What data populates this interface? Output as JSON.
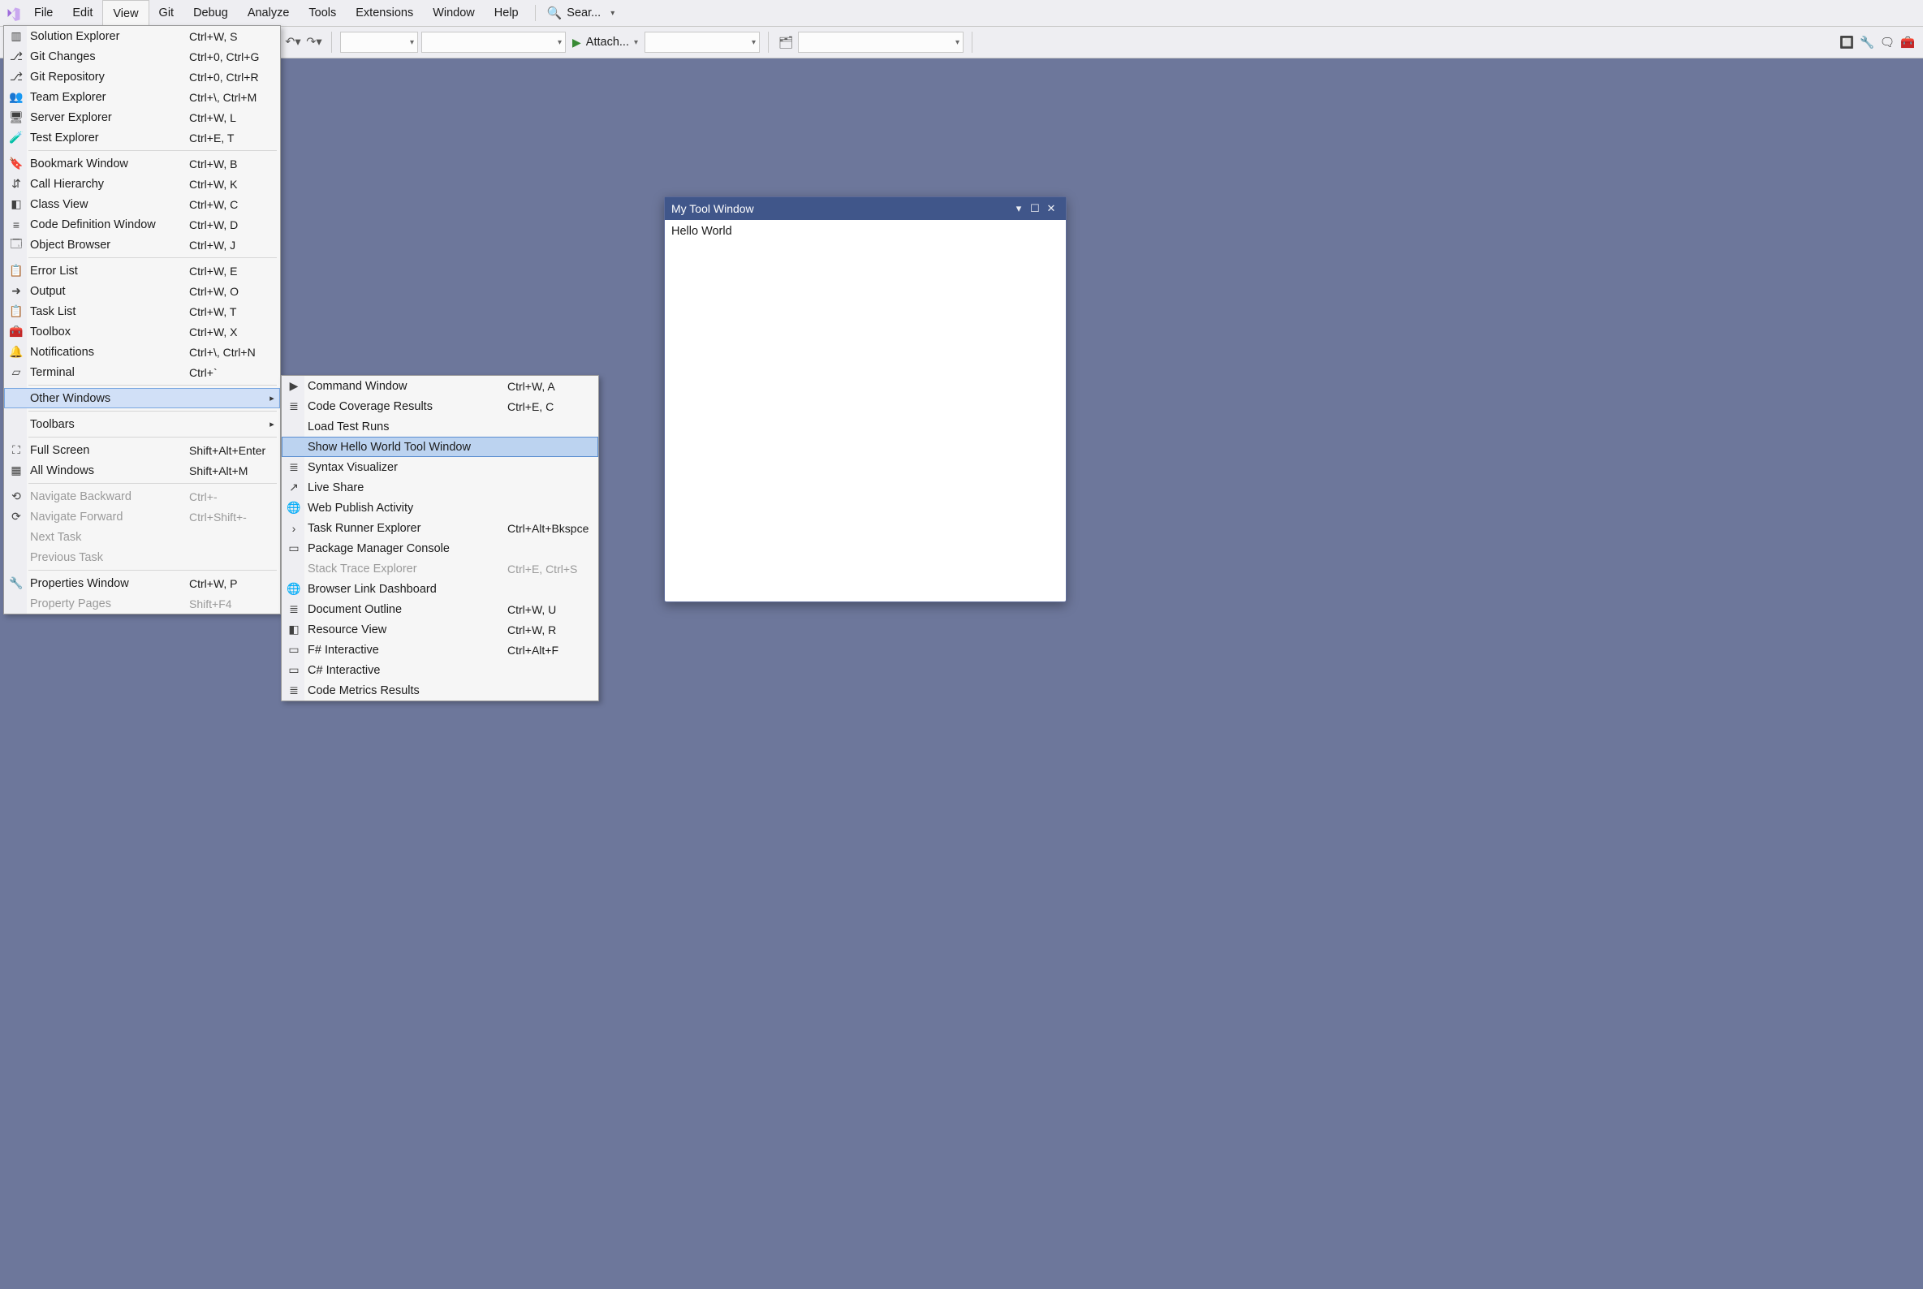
{
  "menubar": {
    "items": [
      "File",
      "Edit",
      "View",
      "Git",
      "Debug",
      "Analyze",
      "Tools",
      "Extensions",
      "Window",
      "Help"
    ],
    "open_index": 2,
    "search_text": "Sear..."
  },
  "toolbar": {
    "attach_label": "Attach..."
  },
  "view_menu": {
    "groups": [
      [
        {
          "icon": "solution",
          "label": "Solution Explorer",
          "shortcut": "Ctrl+W, S"
        },
        {
          "icon": "gitchanges",
          "label": "Git Changes",
          "shortcut": "Ctrl+0, Ctrl+G"
        },
        {
          "icon": "gitrepo",
          "label": "Git Repository",
          "shortcut": "Ctrl+0, Ctrl+R"
        },
        {
          "icon": "team",
          "label": "Team Explorer",
          "shortcut": "Ctrl+\\, Ctrl+M"
        },
        {
          "icon": "server",
          "label": "Server Explorer",
          "shortcut": "Ctrl+W, L"
        },
        {
          "icon": "test",
          "label": "Test Explorer",
          "shortcut": "Ctrl+E, T"
        }
      ],
      [
        {
          "icon": "bookmark",
          "label": "Bookmark Window",
          "shortcut": "Ctrl+W, B"
        },
        {
          "icon": "callhier",
          "label": "Call Hierarchy",
          "shortcut": "Ctrl+W, K"
        },
        {
          "icon": "classview",
          "label": "Class View",
          "shortcut": "Ctrl+W, C"
        },
        {
          "icon": "codedef",
          "label": "Code Definition Window",
          "shortcut": "Ctrl+W, D"
        },
        {
          "icon": "objbrowser",
          "label": "Object Browser",
          "shortcut": "Ctrl+W, J"
        }
      ],
      [
        {
          "icon": "errorlist",
          "label": "Error List",
          "shortcut": "Ctrl+W, E"
        },
        {
          "icon": "output",
          "label": "Output",
          "shortcut": "Ctrl+W, O"
        },
        {
          "icon": "tasklist",
          "label": "Task List",
          "shortcut": "Ctrl+W, T"
        },
        {
          "icon": "toolbox",
          "label": "Toolbox",
          "shortcut": "Ctrl+W, X"
        },
        {
          "icon": "notif",
          "label": "Notifications",
          "shortcut": "Ctrl+\\, Ctrl+N"
        },
        {
          "icon": "terminal",
          "label": "Terminal",
          "shortcut": "Ctrl+`"
        }
      ],
      [
        {
          "icon": "",
          "label": "Other Windows",
          "shortcut": "",
          "submenu": true,
          "selected": true
        }
      ],
      [
        {
          "icon": "",
          "label": "Toolbars",
          "shortcut": "",
          "submenu": true
        }
      ],
      [
        {
          "icon": "fullscreen",
          "label": "Full Screen",
          "shortcut": "Shift+Alt+Enter"
        },
        {
          "icon": "allwin",
          "label": "All Windows",
          "shortcut": "Shift+Alt+M"
        }
      ],
      [
        {
          "icon": "navback",
          "label": "Navigate Backward",
          "shortcut": "Ctrl+-",
          "disabled": true
        },
        {
          "icon": "navfwd",
          "label": "Navigate Forward",
          "shortcut": "Ctrl+Shift+-",
          "disabled": true
        },
        {
          "icon": "",
          "label": "Next Task",
          "shortcut": "",
          "disabled": true
        },
        {
          "icon": "",
          "label": "Previous Task",
          "shortcut": "",
          "disabled": true
        }
      ],
      [
        {
          "icon": "props",
          "label": "Properties Window",
          "shortcut": "Ctrl+W, P"
        },
        {
          "icon": "",
          "label": "Property Pages",
          "shortcut": "Shift+F4",
          "disabled": true
        }
      ]
    ]
  },
  "sub_menu": {
    "items": [
      {
        "icon": "cmd",
        "label": "Command Window",
        "shortcut": "Ctrl+W, A"
      },
      {
        "icon": "coverage",
        "label": "Code Coverage Results",
        "shortcut": "Ctrl+E, C"
      },
      {
        "icon": "",
        "label": "Load Test Runs",
        "shortcut": ""
      },
      {
        "icon": "",
        "label": "Show Hello World Tool Window",
        "shortcut": "",
        "selected": true
      },
      {
        "icon": "syntax",
        "label": "Syntax Visualizer",
        "shortcut": ""
      },
      {
        "icon": "liveshare",
        "label": "Live Share",
        "shortcut": ""
      },
      {
        "icon": "webpub",
        "label": "Web Publish Activity",
        "shortcut": ""
      },
      {
        "icon": "taskrunner",
        "label": "Task Runner Explorer",
        "shortcut": "Ctrl+Alt+Bkspce"
      },
      {
        "icon": "pkg",
        "label": "Package Manager Console",
        "shortcut": ""
      },
      {
        "icon": "",
        "label": "Stack Trace Explorer",
        "shortcut": "Ctrl+E, Ctrl+S",
        "disabled": true
      },
      {
        "icon": "browserlink",
        "label": "Browser Link Dashboard",
        "shortcut": ""
      },
      {
        "icon": "docoutline",
        "label": "Document Outline",
        "shortcut": "Ctrl+W, U"
      },
      {
        "icon": "resource",
        "label": "Resource View",
        "shortcut": "Ctrl+W, R"
      },
      {
        "icon": "fsharp",
        "label": "F# Interactive",
        "shortcut": "Ctrl+Alt+F"
      },
      {
        "icon": "csharp",
        "label": "C# Interactive",
        "shortcut": ""
      },
      {
        "icon": "metrics",
        "label": "Code Metrics Results",
        "shortcut": ""
      }
    ]
  },
  "tool_window": {
    "title": "My Tool Window",
    "body": "Hello World"
  }
}
